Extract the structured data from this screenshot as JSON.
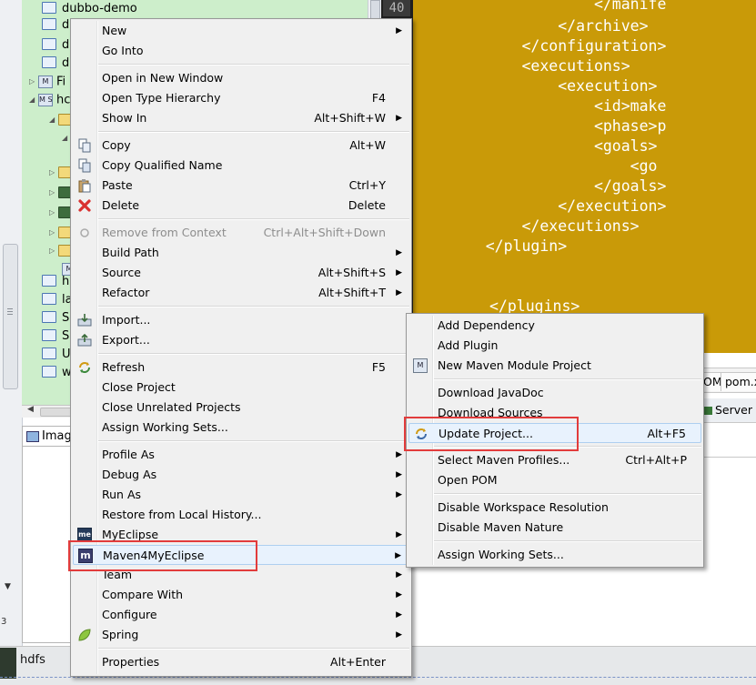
{
  "tree": {
    "rows": [
      {
        "label": "dubbo-demo"
      },
      {
        "label": "d"
      },
      {
        "label": "d"
      },
      {
        "label": "d"
      },
      {
        "label": "Fi"
      },
      {
        "label": "hc"
      },
      {
        "label": "h"
      },
      {
        "label": "la"
      },
      {
        "label": "Sc"
      },
      {
        "label": "Sc"
      },
      {
        "label": "U"
      },
      {
        "label": "w"
      }
    ],
    "mini_labels": [
      "M",
      "M S"
    ]
  },
  "gutter": {
    "line_number": "40"
  },
  "editor": {
    "lines": [
      "                </manife",
      "            </archive>",
      "        </configuration>",
      "        <executions>",
      "            <execution>",
      "                <id>make",
      "                <phase>p",
      "                <goals>",
      "                    <go",
      "                </goals>",
      "            </execution>",
      "        </executions>",
      "    </plugin>",
      "",
      "",
      "</plugins>"
    ],
    "tabs": [
      "OM",
      "pom.x"
    ]
  },
  "servers": {
    "label": "Server"
  },
  "image_panel": {
    "title": "Image"
  },
  "status": {
    "label": "hdfs",
    "left_number": "3"
  },
  "left": {
    "grip": "≡"
  },
  "context_menu": {
    "items": [
      {
        "label": "New",
        "accel": "",
        "submenu": true
      },
      {
        "label": "Go Into",
        "accel": "",
        "submenu": false
      },
      {
        "label": "Open in New Window",
        "accel": "",
        "submenu": false
      },
      {
        "label": "Open Type Hierarchy",
        "accel": "F4",
        "submenu": false
      },
      {
        "label": "Show In",
        "accel": "Alt+Shift+W",
        "submenu": true
      },
      {
        "label": "Copy",
        "accel": "Alt+W",
        "submenu": false
      },
      {
        "label": "Copy Qualified Name",
        "accel": "",
        "submenu": false
      },
      {
        "label": "Paste",
        "accel": "Ctrl+Y",
        "submenu": false
      },
      {
        "label": "Delete",
        "accel": "Delete",
        "submenu": false
      },
      {
        "label": "Remove from Context",
        "accel": "Ctrl+Alt+Shift+Down",
        "submenu": false
      },
      {
        "label": "Build Path",
        "accel": "",
        "submenu": true
      },
      {
        "label": "Source",
        "accel": "Alt+Shift+S",
        "submenu": true
      },
      {
        "label": "Refactor",
        "accel": "Alt+Shift+T",
        "submenu": true
      },
      {
        "label": "Import...",
        "accel": "",
        "submenu": false
      },
      {
        "label": "Export...",
        "accel": "",
        "submenu": false
      },
      {
        "label": "Refresh",
        "accel": "F5",
        "submenu": false
      },
      {
        "label": "Close Project",
        "accel": "",
        "submenu": false
      },
      {
        "label": "Close Unrelated Projects",
        "accel": "",
        "submenu": false
      },
      {
        "label": "Assign Working Sets...",
        "accel": "",
        "submenu": false
      },
      {
        "label": "Profile As",
        "accel": "",
        "submenu": true
      },
      {
        "label": "Debug As",
        "accel": "",
        "submenu": true
      },
      {
        "label": "Run As",
        "accel": "",
        "submenu": true
      },
      {
        "label": "Restore from Local History...",
        "accel": "",
        "submenu": false
      },
      {
        "label": "MyEclipse",
        "accel": "",
        "submenu": true
      },
      {
        "label": "Maven4MyEclipse",
        "accel": "",
        "submenu": true
      },
      {
        "label": "Team",
        "accel": "",
        "submenu": true
      },
      {
        "label": "Compare With",
        "accel": "",
        "submenu": true
      },
      {
        "label": "Configure",
        "accel": "",
        "submenu": true
      },
      {
        "label": "Spring",
        "accel": "",
        "submenu": true
      },
      {
        "label": "Properties",
        "accel": "Alt+Enter",
        "submenu": false
      }
    ],
    "icon_text": {
      "myeclipse": "me",
      "maven": "m"
    }
  },
  "submenu": {
    "items": [
      {
        "label": "Add Dependency",
        "accel": ""
      },
      {
        "label": "Add Plugin",
        "accel": ""
      },
      {
        "label": "New Maven Module Project",
        "accel": ""
      },
      {
        "label": "Download JavaDoc",
        "accel": ""
      },
      {
        "label": "Download Sources",
        "accel": ""
      },
      {
        "label": "Update Project...",
        "accel": "Alt+F5"
      },
      {
        "label": "Select Maven Profiles...",
        "accel": "Ctrl+Alt+P"
      },
      {
        "label": "Open POM",
        "accel": ""
      },
      {
        "label": "Disable Workspace Resolution",
        "accel": ""
      },
      {
        "label": "Disable Maven Nature",
        "accel": ""
      },
      {
        "label": "Assign Working Sets...",
        "accel": ""
      }
    ],
    "icon_text": {
      "module": "M"
    }
  },
  "colors": {
    "editor_bg": "#c99a08",
    "tree_bg": "#cdeecb",
    "highlight": "#e23c3c",
    "menu_bg": "#f0f0f0"
  }
}
